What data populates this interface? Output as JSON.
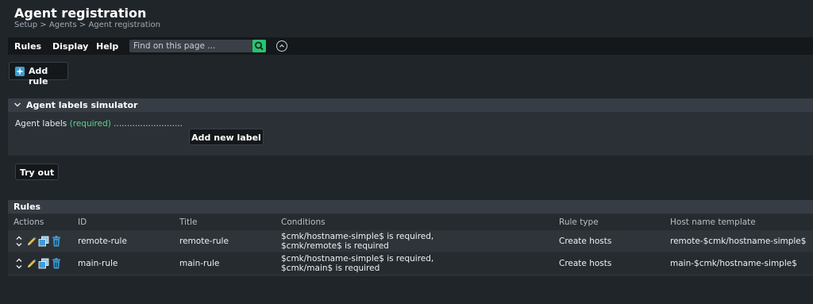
{
  "header": {
    "title": "Agent registration",
    "breadcrumb": [
      "Setup",
      "Agents",
      "Agent registration"
    ],
    "separator": ">"
  },
  "menubar": {
    "items": [
      "Rules",
      "Display",
      "Help"
    ],
    "search_placeholder": "Find on this page ..."
  },
  "toolbar": {
    "add_rule_label": "Add rule"
  },
  "simulator": {
    "title": "Agent labels simulator",
    "agent_labels_label": "Agent labels",
    "required_text": "(required)",
    "dots": "..........................",
    "add_new_label": "Add new label",
    "try_out_label": "Try out"
  },
  "rules": {
    "title": "Rules",
    "columns": [
      "Actions",
      "ID",
      "Title",
      "Conditions",
      "Rule type",
      "Host name template"
    ],
    "rows": [
      {
        "id": "remote-rule",
        "title": "remote-rule",
        "conditions": [
          "$cmk/hostname-simple$ is required,",
          "$cmk/remote$ is required"
        ],
        "rule_type": "Create hosts",
        "host_name_template": "remote-$cmk/hostname-simple$"
      },
      {
        "id": "main-rule",
        "title": "main-rule",
        "conditions": [
          "$cmk/hostname-simple$ is required,",
          "$cmk/main$ is required"
        ],
        "rule_type": "Create hosts",
        "host_name_template": "main-$cmk/hostname-simple$"
      }
    ]
  },
  "icons": {
    "move": "move-updown-icon",
    "edit": "pencil-icon",
    "clone": "clone-icon",
    "delete": "trash-icon",
    "search": "search-icon",
    "collapse": "chevron-up-circle-icon",
    "add": "plus-icon"
  },
  "colors": {
    "background": "#20252a",
    "panel": "#2a3036",
    "accent_green": "#27c36f",
    "required_green": "#5fd38c",
    "icon_blue": "#3f9bd6"
  }
}
